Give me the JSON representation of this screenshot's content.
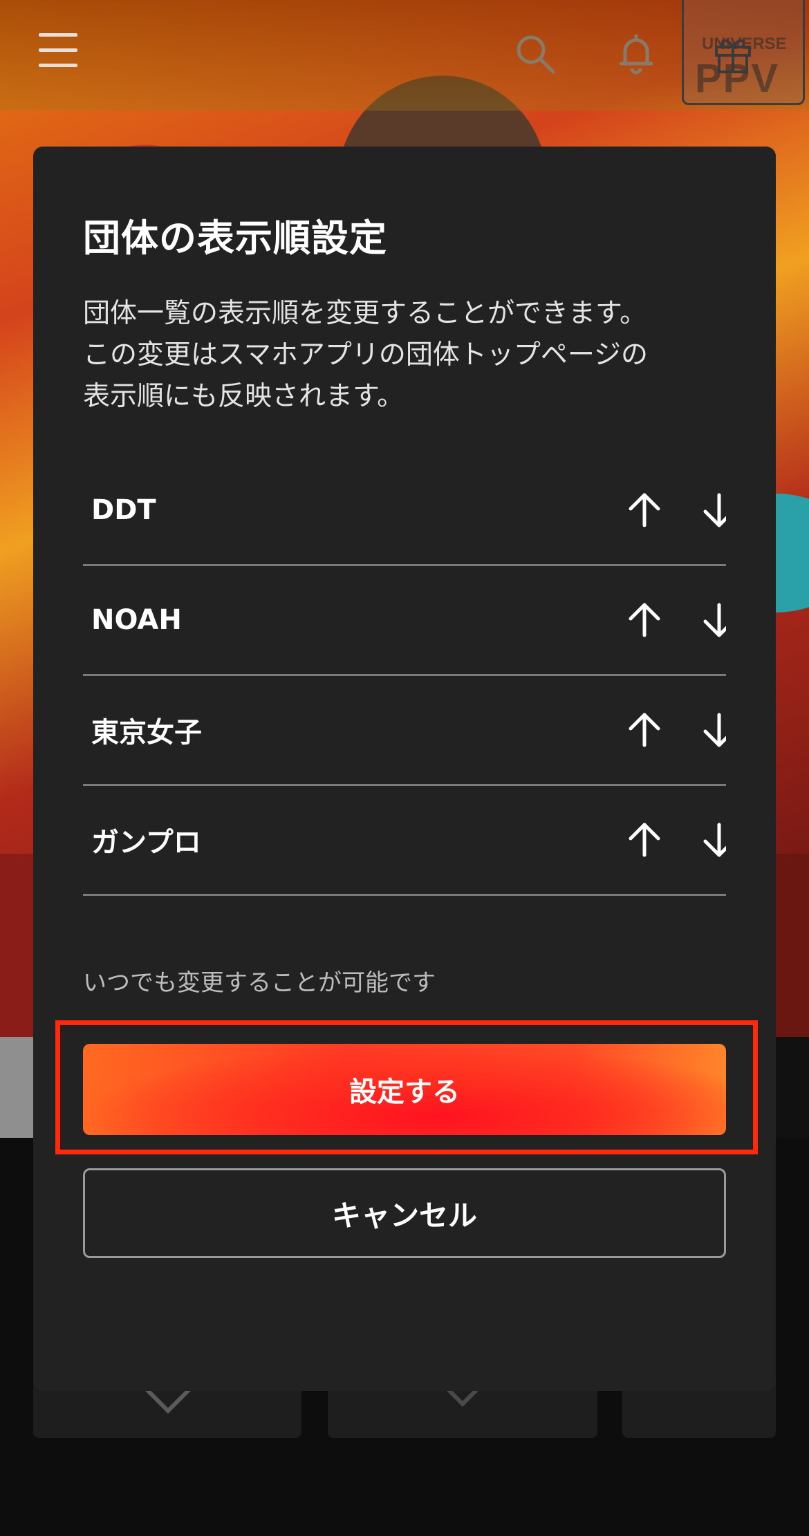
{
  "modal": {
    "title": "団体の表示順設定",
    "description_lines": [
      "団体一覧の表示順を変更することができます。",
      "この変更はスマホアプリの団体トップページの",
      "表示順にも反映されます。"
    ],
    "items": [
      {
        "label": "DDT"
      },
      {
        "label": "NOAH"
      },
      {
        "label": "東京女子"
      },
      {
        "label": "ガンプロ"
      },
      {
        "label": ""
      }
    ],
    "note": "いつでも変更することが可能です",
    "confirm_label": "設定する",
    "cancel_label": "キャンセル"
  },
  "header": {
    "icons": [
      "menu-icon",
      "search-icon",
      "bell-icon",
      "gift-icon"
    ],
    "badge_text": "PPV",
    "badge_sub": "UNIVERSE"
  },
  "colors": {
    "modal_bg": "#222222",
    "accent": "#ff3a24",
    "highlight": "#ff2a0e"
  }
}
